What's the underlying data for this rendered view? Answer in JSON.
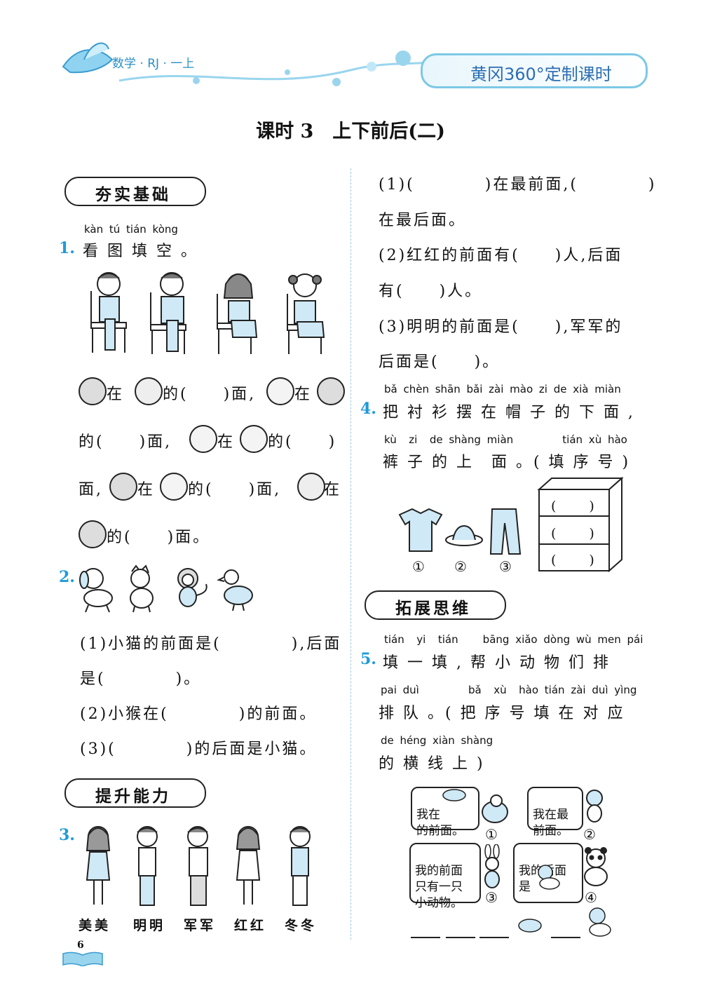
{
  "header": {
    "left": "数学 · RJ · 一上",
    "right": "黄冈360°定制课时"
  },
  "title": "课时 3　上下前后(二)",
  "sections": {
    "basic": "夯实基础",
    "improve": "提升能力",
    "expand": "拓展思维"
  },
  "q1": {
    "num": "1.",
    "pinyin": "kàn  tú  tián kòng",
    "text": "看 图 填 空 。",
    "line1_a": "在",
    "line1_b": "的(　　)面,",
    "line1_c": "在",
    "line2_a": "的(　　)面,",
    "line2_b": "在",
    "line2_c": "的(　　)",
    "line3_a": "面,",
    "line3_b": "在",
    "line3_c": "的(　　)面,",
    "line3_d": "在",
    "line4_a": "的(　　)面。"
  },
  "q2": {
    "num": "2.",
    "s1a": "(1)小猫的前面是(　　　　),后面",
    "s1b": "是(　　　　)。",
    "s2": "(2)小猴在(　　　　)的前面。",
    "s3": "(3)(　　　　)的后面是小猫。"
  },
  "q3": {
    "num": "3.",
    "names": [
      "美美",
      "明明",
      "军军",
      "红红",
      "冬冬"
    ],
    "s1a": "(1)(　　　　)在最前面,(　　　　)",
    "s1b": "在最后面。",
    "s2a": "(2)红红的前面有(　　)人,后面",
    "s2b": "有(　　)人。",
    "s3a": "(3)明明的前面是(　　),军军的",
    "s3b": "后面是(　　)。"
  },
  "q4": {
    "num": "4.",
    "pinyin1": "bǎ chèn shān bǎi zài mào  zi  de  xià miàn",
    "text1": "把 衬 衫 摆 在 帽 子 的 下 面 ,",
    "pinyin2": "kù  zi  de shàng miàn        tián xù hào",
    "text2": "裤 子 的 上　面 。( 填 序 号 )",
    "labels": [
      "①",
      "②",
      "③"
    ],
    "shelf": [
      "(　　)",
      "(　　)",
      "(　　)"
    ]
  },
  "q5": {
    "num": "5.",
    "pinyin1": "tián  yi  tián    bāng xiǎo dòng wù men pái",
    "text1": "填 一 填 , 帮 小 动 物 们 排",
    "pinyin2": "pai duì        bǎ  xù  hào tián zài duì yìng",
    "text2": "排 队 。( 把 序 号 填 在 对 应",
    "pinyin3": "de héng xiàn shàng",
    "text3": "的 横 线 上 )",
    "bubble1": "我在\n的前面。",
    "bubble2": "我在最\n前面。",
    "bubble3": "我的前面\n只有一只\n小动物。",
    "bubble4": "我的后面\n是",
    "labels": [
      "①",
      "②",
      "③",
      "④"
    ]
  },
  "page_number": "6",
  "colors": {
    "accent": "#1f9bd8",
    "header_blue": "#2b6db3"
  }
}
